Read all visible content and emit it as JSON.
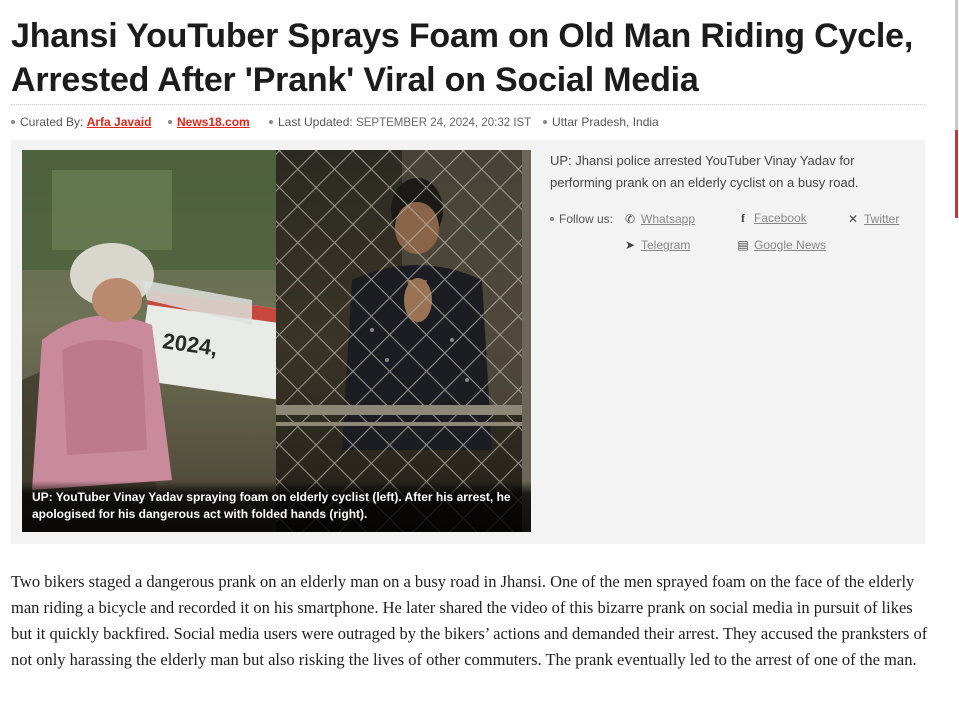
{
  "article": {
    "headline": "Jhansi YouTuber Sprays Foam on Old Man Riding Cycle, Arrested After 'Prank' Viral on Social Media",
    "meta": {
      "curated_by_label": "Curated By:",
      "author": "Arfa Javaid",
      "source": "News18.com",
      "updated_label": "Last Updated:",
      "updated_value": "SEPTEMBER 24, 2024, 20:32 IST",
      "location": "Uttar Pradesh, India"
    },
    "hero": {
      "image_overlay_text": "2024,",
      "caption": "UP: YouTuber Vinay Yadav spraying foam on elderly cyclist (left). After his arrest, he apologised for his dangerous act with folded hands (right)."
    },
    "summary": "UP: Jhansi police arrested YouTuber Vinay Yadav for performing prank on an elderly cyclist on a busy road.",
    "follow": {
      "label": "Follow us:",
      "links": [
        {
          "label": "Whatsapp",
          "icon": "whatsapp-icon"
        },
        {
          "label": "Facebook",
          "icon": "facebook-icon"
        },
        {
          "label": "Twitter",
          "icon": "x-twitter-icon"
        },
        {
          "label": "Telegram",
          "icon": "telegram-icon"
        },
        {
          "label": "Google News",
          "icon": "google-news-icon"
        }
      ]
    },
    "body": "Two bikers staged a dangerous prank on an elderly man on a busy road in Jhansi. One of the men sprayed foam on the face of the elderly man riding a bicycle and recorded it on his smartphone. He later shared the video of this bizarre prank on social media in pursuit of likes but it quickly backfired. Social media users were outraged by the bikers’ actions and demanded their arrest. They accused the pranksters of not only harassing the elderly man but also risking the lives of other commuters. The prank eventually led to the arrest of one of the man."
  },
  "colors": {
    "accent_link": "#e1261c",
    "hero_bg": "#f3f3f3",
    "scroll_accent": "#d32f2f"
  }
}
